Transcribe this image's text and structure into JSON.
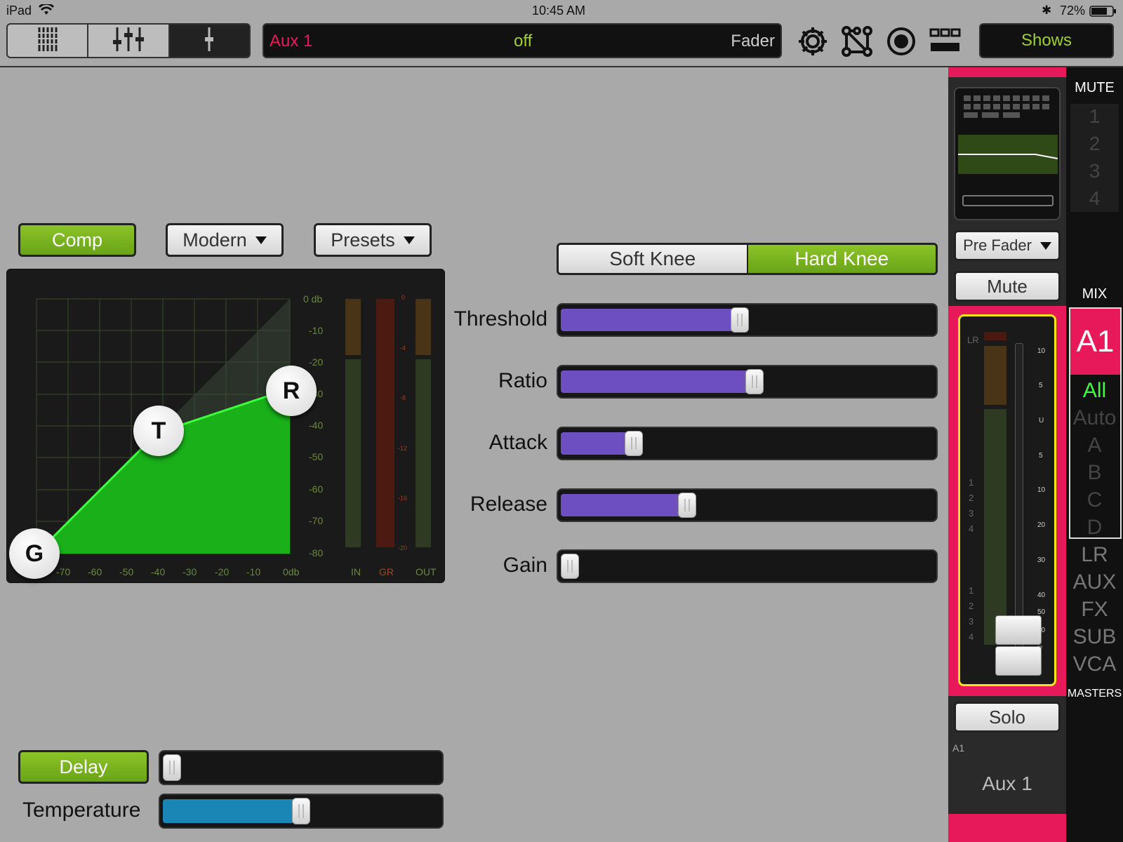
{
  "status_bar": {
    "device": "iPad",
    "time": "10:45 AM",
    "battery": "72%"
  },
  "toolbar": {
    "channel_name": "Aux 1",
    "state": "off",
    "mode": "Fader",
    "shows_label": "Shows",
    "colors": {
      "channel": "#e8195a",
      "state": "#9fd12a"
    }
  },
  "compressor": {
    "comp_label": "Comp",
    "type_label": "Modern",
    "presets_label": "Presets",
    "knee": {
      "soft_label": "Soft Knee",
      "hard_label": "Hard Knee",
      "selected": "Hard Knee"
    },
    "graph": {
      "y_labels": [
        "0 db",
        "-10",
        "-20",
        "-30",
        "-40",
        "-50",
        "-60",
        "-70",
        "-80"
      ],
      "x_labels": [
        "-70",
        "-60",
        "-50",
        "-40",
        "-30",
        "-20",
        "-10",
        "0db"
      ],
      "handles": [
        "G",
        "T",
        "R"
      ],
      "meter_labels": [
        "IN",
        "GR",
        "OUT"
      ],
      "gr_scale": [
        "0",
        "-4",
        "-8",
        "-12",
        "-16",
        "-20"
      ]
    },
    "params": [
      {
        "label": "Threshold",
        "value": 0.48
      },
      {
        "label": "Ratio",
        "value": 0.52
      },
      {
        "label": "Attack",
        "value": 0.18
      },
      {
        "label": "Release",
        "value": 0.33
      },
      {
        "label": "Gain",
        "value": 0.0
      }
    ],
    "slider_color": "#6e4fc2"
  },
  "delay": {
    "label": "Delay",
    "value": 0.0
  },
  "temperature": {
    "label": "Temperature",
    "value": 0.5,
    "color": "#1a86b5"
  },
  "strip": {
    "pre_fader_label": "Pre Fader",
    "mute_label": "Mute",
    "solo_label": "Solo",
    "channel_id": "A1",
    "channel_name": "Aux 1",
    "meter_label": "LR",
    "group_numbers": [
      "1",
      "2",
      "3",
      "4"
    ],
    "scale": [
      "10",
      "5",
      "U",
      "5",
      "10",
      "20",
      "30",
      "40",
      "50",
      "60",
      "∞"
    ],
    "accent": "#e8195a"
  },
  "rail": {
    "mute_label": "MUTE",
    "mute_groups": [
      "1",
      "2",
      "3",
      "4"
    ],
    "mix_label": "MIX",
    "mix_selected": "A1",
    "filters": [
      "All",
      "Auto",
      "A",
      "B",
      "C",
      "D"
    ],
    "buses": [
      "LR",
      "AUX",
      "FX",
      "SUB",
      "VCA"
    ],
    "masters_label": "MASTERS"
  }
}
